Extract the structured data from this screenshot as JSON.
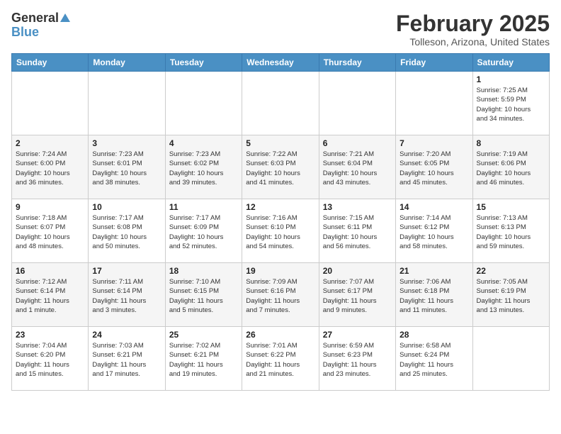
{
  "header": {
    "logo_general": "General",
    "logo_blue": "Blue",
    "month_title": "February 2025",
    "location": "Tolleson, Arizona, United States"
  },
  "days_of_week": [
    "Sunday",
    "Monday",
    "Tuesday",
    "Wednesday",
    "Thursday",
    "Friday",
    "Saturday"
  ],
  "weeks": [
    [
      {
        "day": "",
        "info": ""
      },
      {
        "day": "",
        "info": ""
      },
      {
        "day": "",
        "info": ""
      },
      {
        "day": "",
        "info": ""
      },
      {
        "day": "",
        "info": ""
      },
      {
        "day": "",
        "info": ""
      },
      {
        "day": "1",
        "info": "Sunrise: 7:25 AM\nSunset: 5:59 PM\nDaylight: 10 hours\nand 34 minutes."
      }
    ],
    [
      {
        "day": "2",
        "info": "Sunrise: 7:24 AM\nSunset: 6:00 PM\nDaylight: 10 hours\nand 36 minutes."
      },
      {
        "day": "3",
        "info": "Sunrise: 7:23 AM\nSunset: 6:01 PM\nDaylight: 10 hours\nand 38 minutes."
      },
      {
        "day": "4",
        "info": "Sunrise: 7:23 AM\nSunset: 6:02 PM\nDaylight: 10 hours\nand 39 minutes."
      },
      {
        "day": "5",
        "info": "Sunrise: 7:22 AM\nSunset: 6:03 PM\nDaylight: 10 hours\nand 41 minutes."
      },
      {
        "day": "6",
        "info": "Sunrise: 7:21 AM\nSunset: 6:04 PM\nDaylight: 10 hours\nand 43 minutes."
      },
      {
        "day": "7",
        "info": "Sunrise: 7:20 AM\nSunset: 6:05 PM\nDaylight: 10 hours\nand 45 minutes."
      },
      {
        "day": "8",
        "info": "Sunrise: 7:19 AM\nSunset: 6:06 PM\nDaylight: 10 hours\nand 46 minutes."
      }
    ],
    [
      {
        "day": "9",
        "info": "Sunrise: 7:18 AM\nSunset: 6:07 PM\nDaylight: 10 hours\nand 48 minutes."
      },
      {
        "day": "10",
        "info": "Sunrise: 7:17 AM\nSunset: 6:08 PM\nDaylight: 10 hours\nand 50 minutes."
      },
      {
        "day": "11",
        "info": "Sunrise: 7:17 AM\nSunset: 6:09 PM\nDaylight: 10 hours\nand 52 minutes."
      },
      {
        "day": "12",
        "info": "Sunrise: 7:16 AM\nSunset: 6:10 PM\nDaylight: 10 hours\nand 54 minutes."
      },
      {
        "day": "13",
        "info": "Sunrise: 7:15 AM\nSunset: 6:11 PM\nDaylight: 10 hours\nand 56 minutes."
      },
      {
        "day": "14",
        "info": "Sunrise: 7:14 AM\nSunset: 6:12 PM\nDaylight: 10 hours\nand 58 minutes."
      },
      {
        "day": "15",
        "info": "Sunrise: 7:13 AM\nSunset: 6:13 PM\nDaylight: 10 hours\nand 59 minutes."
      }
    ],
    [
      {
        "day": "16",
        "info": "Sunrise: 7:12 AM\nSunset: 6:14 PM\nDaylight: 11 hours\nand 1 minute."
      },
      {
        "day": "17",
        "info": "Sunrise: 7:11 AM\nSunset: 6:14 PM\nDaylight: 11 hours\nand 3 minutes."
      },
      {
        "day": "18",
        "info": "Sunrise: 7:10 AM\nSunset: 6:15 PM\nDaylight: 11 hours\nand 5 minutes."
      },
      {
        "day": "19",
        "info": "Sunrise: 7:09 AM\nSunset: 6:16 PM\nDaylight: 11 hours\nand 7 minutes."
      },
      {
        "day": "20",
        "info": "Sunrise: 7:07 AM\nSunset: 6:17 PM\nDaylight: 11 hours\nand 9 minutes."
      },
      {
        "day": "21",
        "info": "Sunrise: 7:06 AM\nSunset: 6:18 PM\nDaylight: 11 hours\nand 11 minutes."
      },
      {
        "day": "22",
        "info": "Sunrise: 7:05 AM\nSunset: 6:19 PM\nDaylight: 11 hours\nand 13 minutes."
      }
    ],
    [
      {
        "day": "23",
        "info": "Sunrise: 7:04 AM\nSunset: 6:20 PM\nDaylight: 11 hours\nand 15 minutes."
      },
      {
        "day": "24",
        "info": "Sunrise: 7:03 AM\nSunset: 6:21 PM\nDaylight: 11 hours\nand 17 minutes."
      },
      {
        "day": "25",
        "info": "Sunrise: 7:02 AM\nSunset: 6:21 PM\nDaylight: 11 hours\nand 19 minutes."
      },
      {
        "day": "26",
        "info": "Sunrise: 7:01 AM\nSunset: 6:22 PM\nDaylight: 11 hours\nand 21 minutes."
      },
      {
        "day": "27",
        "info": "Sunrise: 6:59 AM\nSunset: 6:23 PM\nDaylight: 11 hours\nand 23 minutes."
      },
      {
        "day": "28",
        "info": "Sunrise: 6:58 AM\nSunset: 6:24 PM\nDaylight: 11 hours\nand 25 minutes."
      },
      {
        "day": "",
        "info": ""
      }
    ]
  ]
}
